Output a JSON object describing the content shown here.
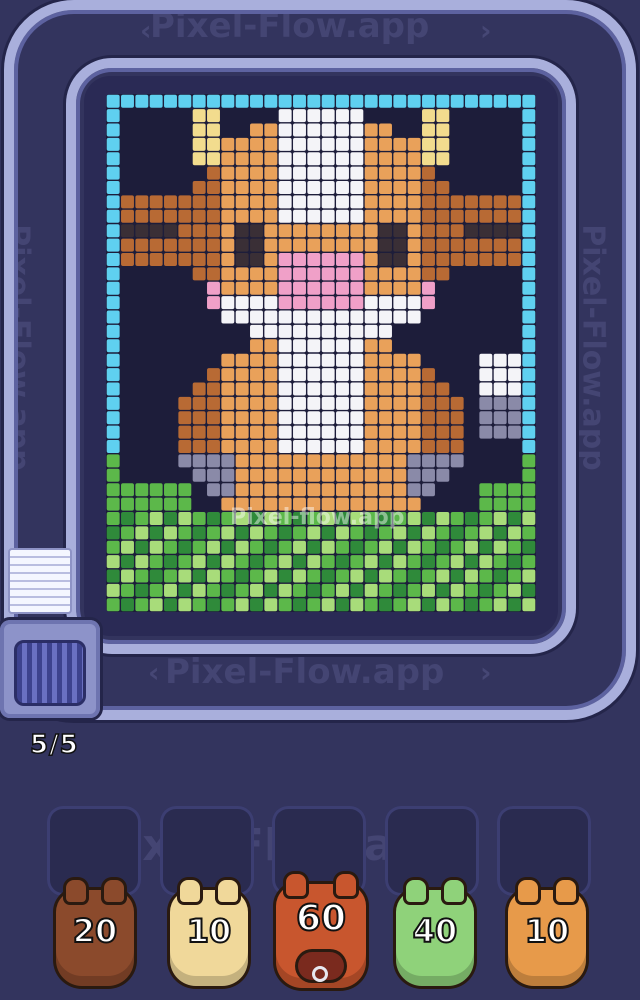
{
  "watermark_text": "Pixel-Flow.app",
  "board_watermark_text": "Pixel-flow.app",
  "dispenser": {
    "counter": "5/5"
  },
  "colors": {
    "background": "#33345e",
    "track": "#a9afdc",
    "border_cyan": "#5fd0f0"
  },
  "shooters": [
    {
      "count": "20",
      "color": "#8b4a2c"
    },
    {
      "count": "10",
      "color": "#f0d89a"
    },
    {
      "count": "60",
      "color": "#c8562e"
    },
    {
      "count": "40",
      "color": "#8fd27a"
    },
    {
      "count": "10",
      "color": "#e79a4a"
    }
  ],
  "slots": [
    "",
    "",
    "",
    "",
    ""
  ]
}
